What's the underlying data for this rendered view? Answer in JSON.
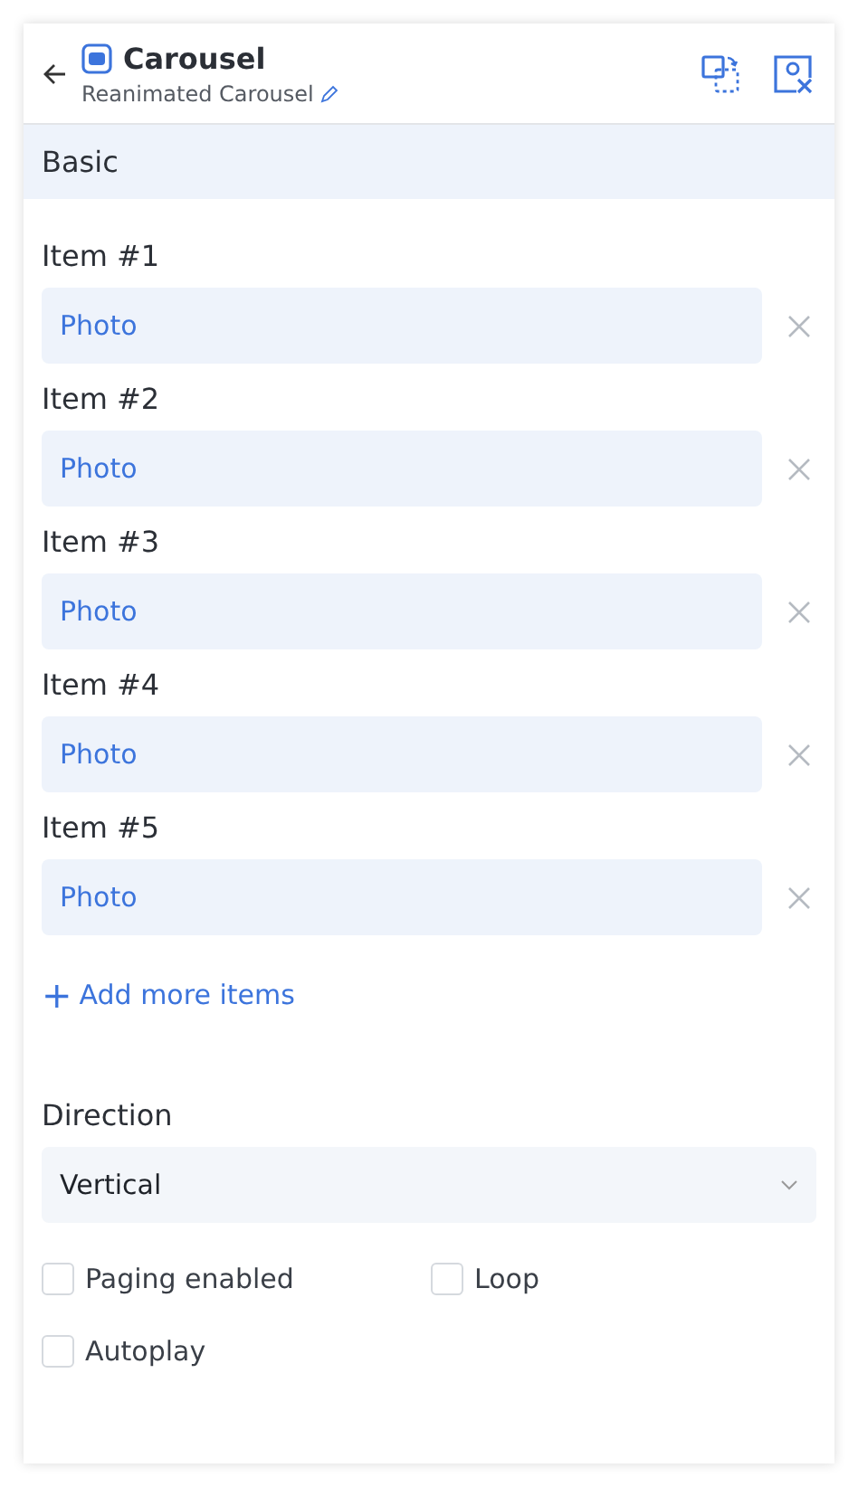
{
  "header": {
    "title": "Carousel",
    "subtitle": "Reanimated Carousel"
  },
  "section": {
    "title": "Basic"
  },
  "items": [
    {
      "label": "Item #1",
      "value": "Photo"
    },
    {
      "label": "Item #2",
      "value": "Photo"
    },
    {
      "label": "Item #3",
      "value": "Photo"
    },
    {
      "label": "Item #4",
      "value": "Photo"
    },
    {
      "label": "Item #5",
      "value": "Photo"
    }
  ],
  "add_button": {
    "icon": "+",
    "label": "Add more items"
  },
  "direction": {
    "label": "Direction",
    "value": "Vertical"
  },
  "options": [
    {
      "label": "Paging enabled",
      "checked": false
    },
    {
      "label": "Loop",
      "checked": false
    },
    {
      "label": "Autoplay",
      "checked": false
    }
  ]
}
